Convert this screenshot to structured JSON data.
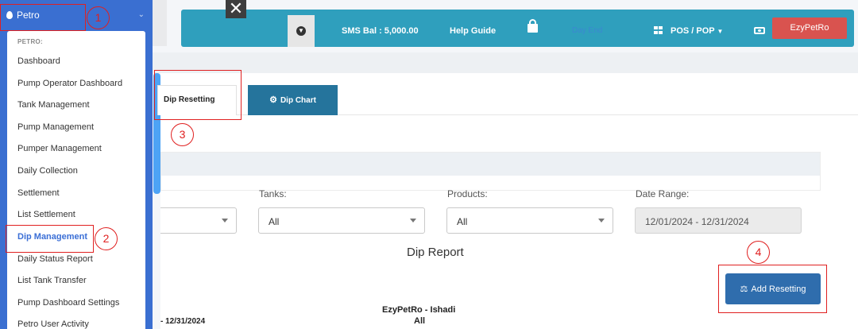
{
  "sidebar": {
    "header_label": "Petro",
    "section_label": "PETRO:",
    "items": [
      {
        "label": "Dashboard"
      },
      {
        "label": "Pump Operator Dashboard"
      },
      {
        "label": "Tank Management"
      },
      {
        "label": "Pump Management"
      },
      {
        "label": "Pumper Management"
      },
      {
        "label": "Daily Collection"
      },
      {
        "label": "Settlement"
      },
      {
        "label": "List Settlement"
      },
      {
        "label": "Dip Management",
        "active": true
      },
      {
        "label": "Daily Status Report"
      },
      {
        "label": "List Tank Transfer"
      },
      {
        "label": "Pump Dashboard Settings"
      },
      {
        "label": "Petro User Activity"
      }
    ]
  },
  "topbar": {
    "close_glyph": "✕",
    "sms_balance": "SMS Bal : 5,000.00",
    "help_guide": "Help Guide",
    "faded_link": "Day End",
    "pos_pop": "POS / POP",
    "business_button": "EzyPetRo"
  },
  "tabs": [
    {
      "label": "Dip Resetting",
      "active": true
    },
    {
      "label": "Dip Chart",
      "icon": "gear-icon"
    }
  ],
  "filters": {
    "tanks_label": "Tanks:",
    "tanks_value": "All",
    "products_label": "Products:",
    "products_value": "All",
    "date_range_label": "Date Range:",
    "date_range_value": "12/01/2024 - 12/31/2024"
  },
  "report": {
    "title": "Dip Report",
    "add_button": "Add Resetting",
    "business_name": "EzyPetRo - Ishadi",
    "date_fragment": "- 12/31/2024",
    "scope": "All"
  },
  "annotations": [
    "1",
    "2",
    "3",
    "4"
  ],
  "colors": {
    "sidebar": "#3a6fd1",
    "topbar": "#2f9fbd",
    "accent_red": "#d9534f",
    "tab_chart": "#25749c",
    "primary_button": "#2f6dad",
    "annotation": "#e02020"
  }
}
